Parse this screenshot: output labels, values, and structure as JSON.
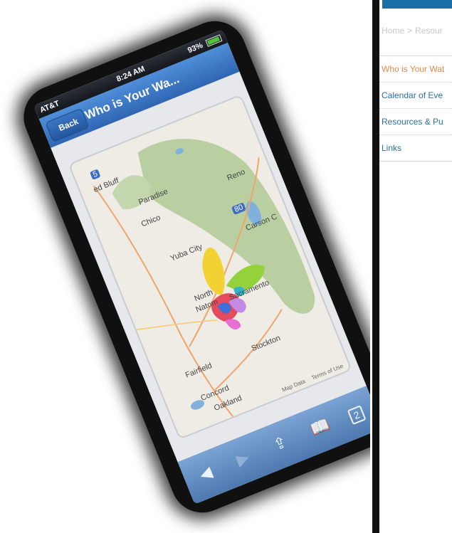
{
  "phone": {
    "status": {
      "carrier": "AT&T",
      "time": "8:24 AM",
      "battery": "93%"
    },
    "nav": {
      "back_label": "Back",
      "title": "Who is Your Wa..."
    },
    "map": {
      "labels": {
        "bluff": "ed Bluff",
        "paradise": "Paradise",
        "chico": "Chico",
        "reno": "Reno",
        "carson": "Carson C",
        "yuba": "Yuba City",
        "north": "North",
        "natomas": "Natom",
        "sacramento": "Sacramento",
        "fairfield": "Fairfield",
        "stockton": "Stockton",
        "concord": "Concord",
        "oakland": "Oakland",
        "i5": "5",
        "i80": "80"
      },
      "footer": {
        "data": "Map Data",
        "terms": "Terms of Use"
      }
    },
    "toolbar": {
      "back": "◀",
      "forward": "▶",
      "share": "⇪",
      "bookmarks": "📖",
      "tabs": "2"
    }
  },
  "site": {
    "breadcrumb": {
      "home": "Home",
      "separator": ">",
      "current": "Resour"
    },
    "nav": [
      {
        "label": "Who is Your Wat",
        "active": true
      },
      {
        "label": "Calendar of Eve",
        "active": false
      },
      {
        "label": "Resources & Pu",
        "active": false
      },
      {
        "label": "Links",
        "active": false
      }
    ],
    "colors": {
      "header": "#1b6fa8",
      "link": "#2b6fa5",
      "active_link": "#e8894c"
    }
  }
}
